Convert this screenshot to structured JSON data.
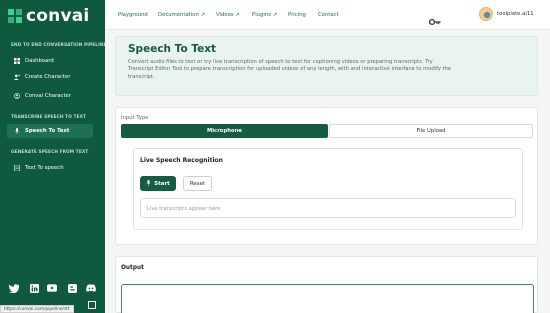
{
  "brand": {
    "name": "convai",
    "accent": "#3ccf8e",
    "sidebar_bg": "#0f5a3e",
    "primary": "#165c40"
  },
  "sidebar": {
    "sections": [
      {
        "title": "END TO END CONVERSATION PIPELINE",
        "items": [
          {
            "label": "Dashboard",
            "icon": "dashboard-icon"
          },
          {
            "label": "Create Character",
            "icon": "user-plus-icon"
          },
          {
            "label": "Convai Character",
            "icon": "user-icon"
          }
        ]
      },
      {
        "title": "TRANSCRIBE SPEECH TO TEXT",
        "items": [
          {
            "label": "Speech To Text",
            "icon": "mic-icon",
            "active": true
          }
        ]
      },
      {
        "title": "GENERATE SPEECH FROM TEXT",
        "items": [
          {
            "label": "Text To speech",
            "icon": "document-icon"
          }
        ]
      }
    ],
    "social": [
      "twitter-icon",
      "linkedin-icon",
      "youtube-icon",
      "blogger-icon",
      "discord-icon"
    ]
  },
  "topnav": {
    "links": [
      "Playground",
      "Documentation ↗",
      "Videos ↗",
      "Plugins ↗",
      "Pricing",
      "Contact"
    ],
    "username": "toolplate.ai11"
  },
  "hero": {
    "title": "Speech To Text",
    "description": "Convert audio files to text or try live transcription of speech to text for captioning videos or preparing transcripts. Try Transcript Editor Tool to prepare transcription for uploaded videos of any length, with and interactive interface to modify the transcript."
  },
  "input": {
    "label": "Input Type",
    "tabs": [
      "Microphone",
      "File Upload"
    ],
    "live": {
      "title": "Live Speech Recognition",
      "start_label": "Start",
      "reset_label": "Reset",
      "placeholder": "Live transcripts appear here"
    }
  },
  "output": {
    "label": "Output"
  },
  "status_url": "https://convai.com/pipeline/stt"
}
